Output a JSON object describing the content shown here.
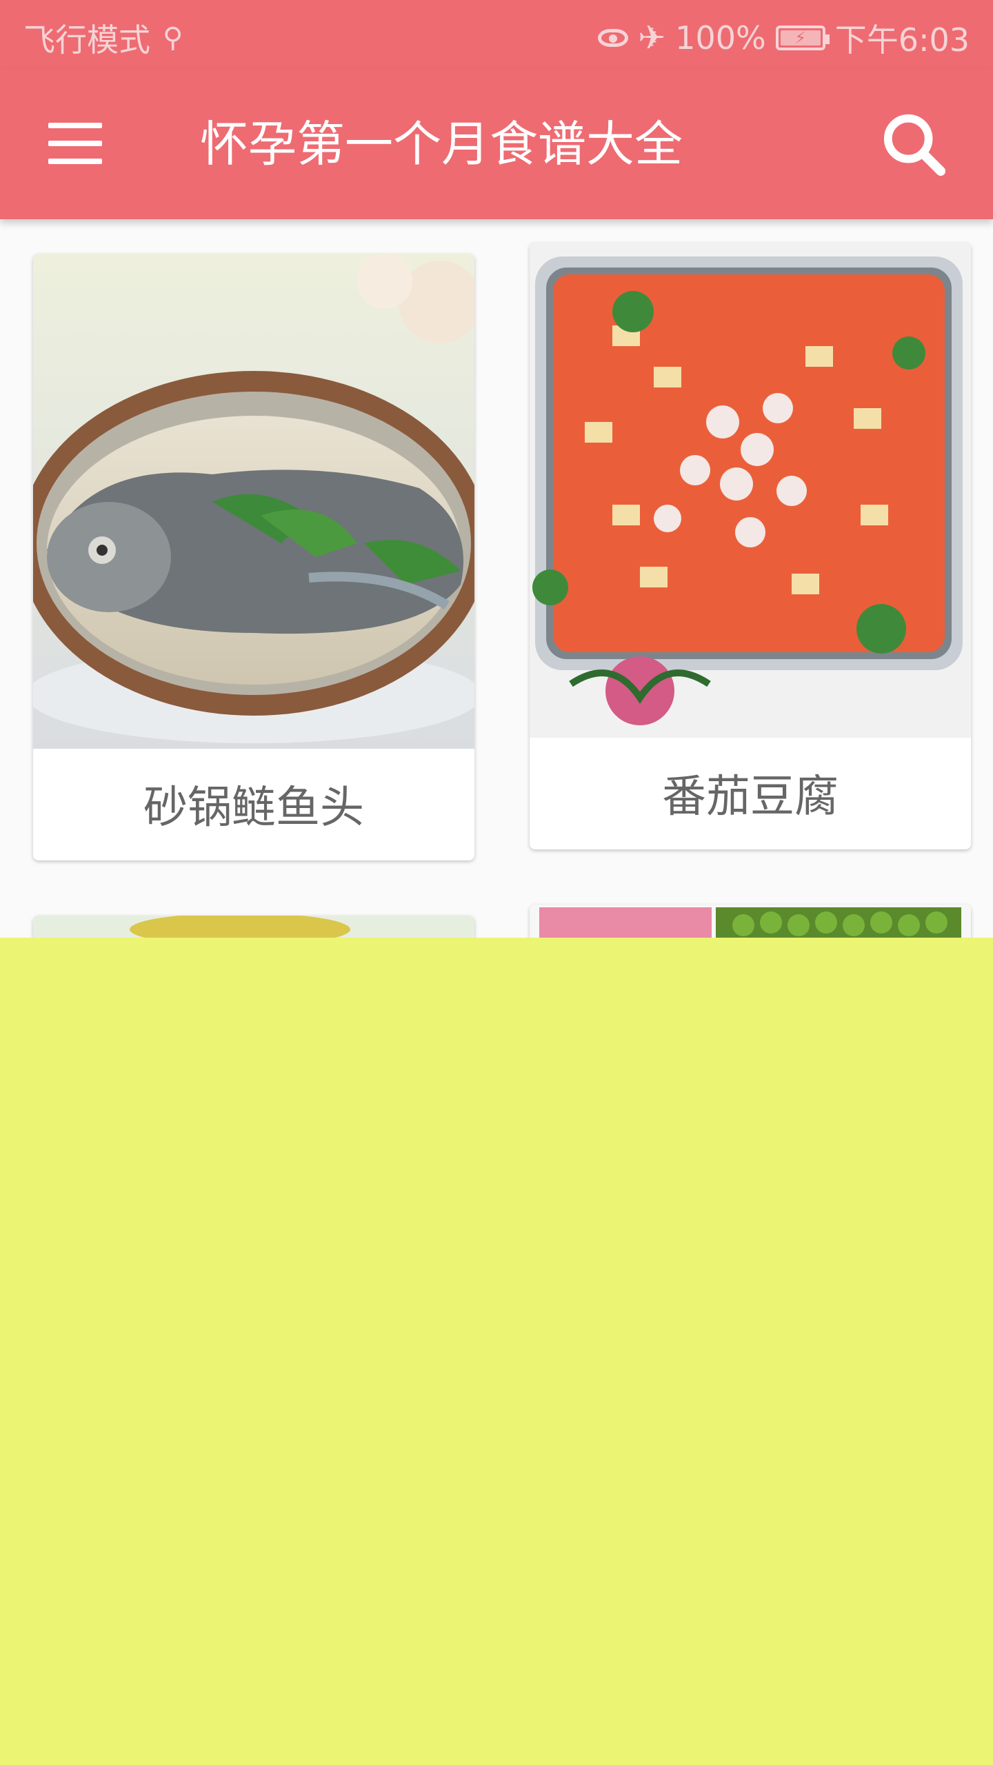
{
  "status_bar": {
    "mode_text": "飞行模式",
    "battery_text": "100%",
    "time_text": "下午6:03"
  },
  "app_bar": {
    "title": "怀孕第一个月食谱大全"
  },
  "recipes": [
    {
      "name": "砂锅鲢鱼头"
    },
    {
      "name": "番茄豆腐"
    }
  ],
  "colors": {
    "primary": "#ee6b72",
    "overlay": "#ebf573"
  }
}
